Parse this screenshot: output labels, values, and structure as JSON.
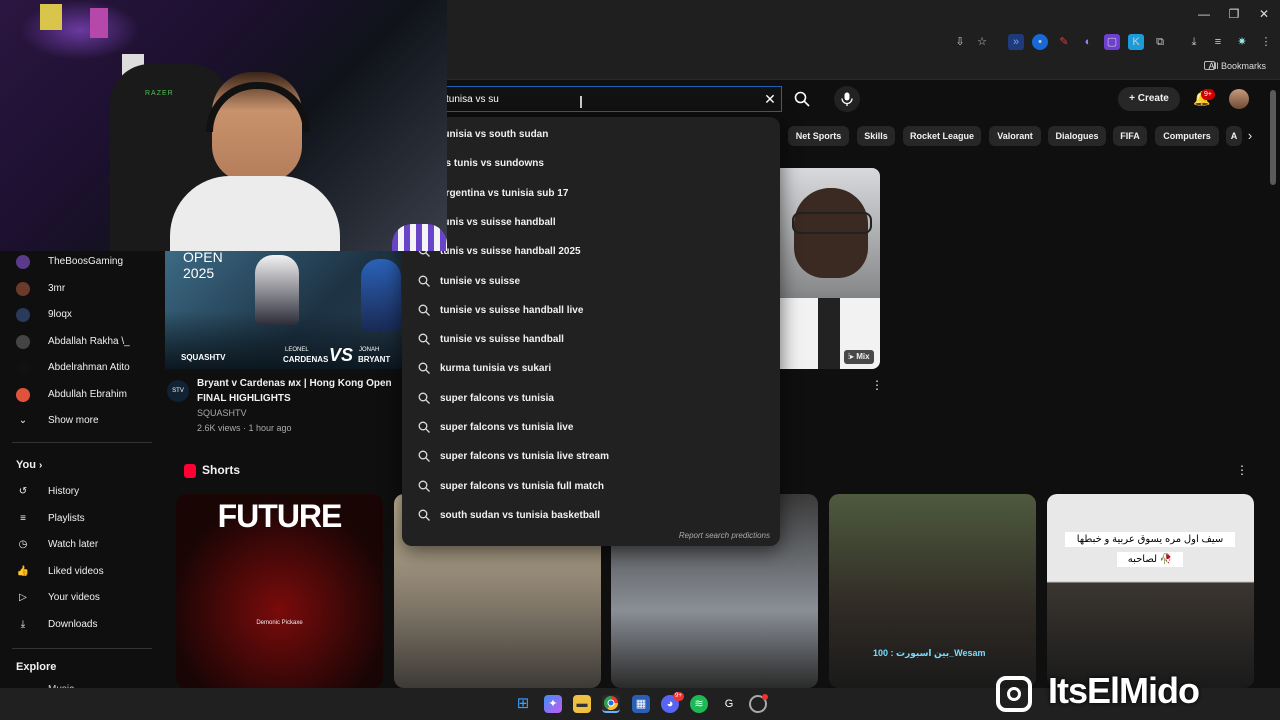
{
  "browser": {
    "bookmarks_label": "All Bookmarks"
  },
  "header": {
    "search_value": "tunisa vs su",
    "create_label": "Create",
    "notifications_badge": "9+"
  },
  "chips": [
    "Net Sports",
    "Skills",
    "Rocket League",
    "Valorant",
    "Dialogues",
    "FIFA",
    "Computers",
    "A"
  ],
  "suggestions": [
    "tunisia vs south sudan",
    "es tunis vs sundowns",
    "argentina vs tunisia sub 17",
    "tunis vs suisse handball",
    "tunis vs suisse handball 2025",
    "tunisie vs suisse",
    "tunisie vs suisse handball live",
    "tunisie vs suisse handball",
    "kurma tunisia vs sukari",
    "super falcons vs tunisia",
    "super falcons vs tunisia live",
    "super falcons vs tunisia live stream",
    "super falcons vs tunisia full match",
    "south sudan vs tunisia basketball"
  ],
  "report_label": "Report search predictions",
  "sidebar": {
    "subscriptions": [
      {
        "name": "TheBoosGaming",
        "color": "#5a3a8a"
      },
      {
        "name": "3mr",
        "color": "#6b3a2a"
      },
      {
        "name": "9loqx",
        "color": "#2a3a5a"
      },
      {
        "name": "Abdallah Rakha \\_",
        "color": "#444444"
      },
      {
        "name": "Abdelrahman Atito",
        "color": "#111111"
      },
      {
        "name": "Abdullah Ebrahim",
        "color": "#e0533b"
      }
    ],
    "show_more": "Show more",
    "you_label": "You",
    "you_items": [
      "History",
      "Playlists",
      "Watch later",
      "Liked videos",
      "Your videos",
      "Downloads"
    ],
    "explore_label": "Explore",
    "music_label": "Music"
  },
  "video1": {
    "title_line1": "Bryant v Cardenas ᴍx | Hong Kong Open",
    "title_line2": "FINAL HIGHLIGHTS",
    "channel": "SQUASHTV",
    "meta": "2.6K views · 1 hour ago",
    "thumb_text1": "OPEN",
    "thumb_text2": "2025",
    "thumb_brand": "SQUASHTV",
    "thumb_p1": "LEONEL",
    "thumb_p1b": "CARDENAS",
    "thumb_vs": "VS",
    "thumb_p2": "JONAH",
    "thumb_p2b": "BRYANT"
  },
  "video2": {
    "badge": "Mix"
  },
  "shorts": {
    "title": "Shorts",
    "short1_text": "FUTURE",
    "short1_sub": "Demonic Pickaxe",
    "short4_overlay": "بين اسبورت : 100_Wesam",
    "short5_caption_l1": "سيف اول مره يسوق عربية و خبطها",
    "short5_caption_l2": "لصاحبه 🥀"
  },
  "watermark": "ItsElMido",
  "webcam_brand": "RAZER"
}
